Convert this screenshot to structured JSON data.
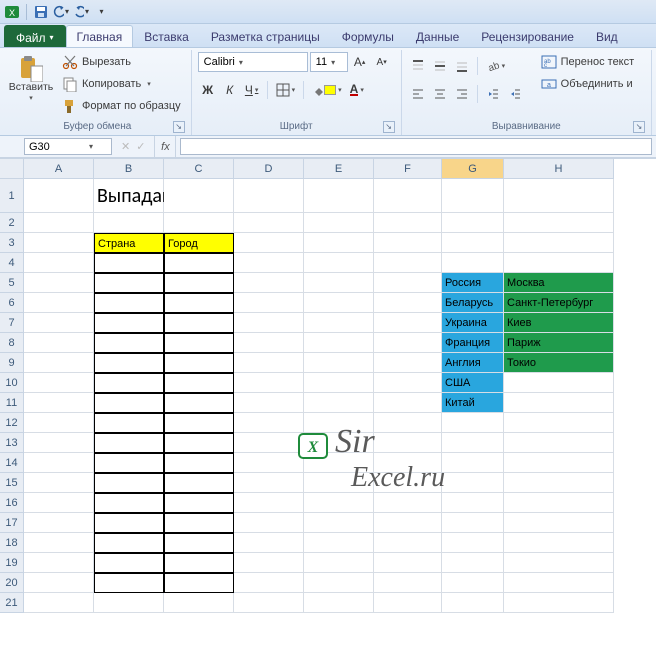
{
  "qat": {
    "save_title": "Сохранить",
    "undo_title": "Отменить",
    "redo_title": "Вернуть"
  },
  "tabs": {
    "file": "Файл",
    "items": [
      "Главная",
      "Вставка",
      "Разметка страницы",
      "Формулы",
      "Данные",
      "Рецензирование",
      "Вид"
    ],
    "active_index": 0
  },
  "ribbon": {
    "clipboard": {
      "paste": "Вставить",
      "cut": "Вырезать",
      "copy": "Копировать",
      "format_painter": "Формат по образцу",
      "group": "Буфер обмена"
    },
    "font": {
      "name": "Calibri",
      "size": "11",
      "bold": "Ж",
      "italic": "К",
      "underline": "Ч",
      "group": "Шрифт"
    },
    "alignment": {
      "wrap": "Перенос текст",
      "merge": "Объединить и",
      "group": "Выравнивание"
    }
  },
  "namebox": "G30",
  "formula": "",
  "columns": [
    "A",
    "B",
    "C",
    "D",
    "E",
    "F",
    "G",
    "H"
  ],
  "row_count": 21,
  "selected_col": "G",
  "cells": {
    "B1": "Выпадающий список",
    "B3": "Страна",
    "C3": "Город"
  },
  "countries": [
    "Россия",
    "Беларусь",
    "Украина",
    "Франция",
    "Англия",
    "США",
    "Китай"
  ],
  "cities": [
    "Москва",
    "Санкт-Петербург",
    "Киев",
    "Париж",
    "Токио"
  ],
  "watermark": {
    "line1": "Sir",
    "line2": "Excel.ru"
  }
}
